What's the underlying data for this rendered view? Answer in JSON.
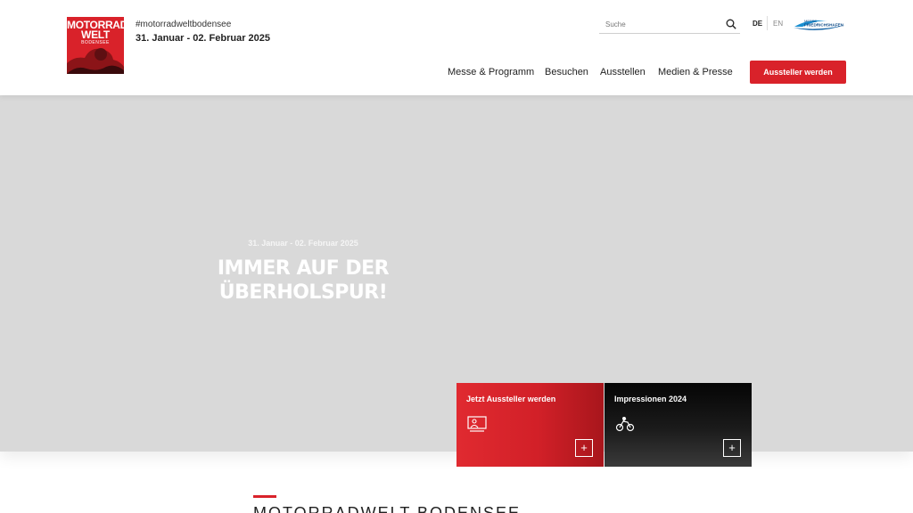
{
  "brand": {
    "logo_line1": "MOTORRAD",
    "logo_line2": "WELT",
    "logo_line3": "BODENSEE",
    "hashtag": "#motorradweltbodensee",
    "dates": "31. Januar - 02. Februar 2025",
    "color": "#d9222a"
  },
  "search": {
    "placeholder": "Suche",
    "icon": "search-icon"
  },
  "language": {
    "de": "DE",
    "en": "EN"
  },
  "partner_logo": {
    "line1": "MESSE",
    "line2": "FRIEDRICHSHAFEN"
  },
  "nav": {
    "items": [
      "Messe & Programm",
      "Besuchen",
      "Ausstellen",
      "Medien & Presse"
    ],
    "cta": "Aussteller werden"
  },
  "hero": {
    "date": "31. Januar - 02. Februar 2025",
    "title_line1": "IMMER AUF DER",
    "title_line2": "ÜBERHOLSPUR!",
    "background": "#d9d9d9"
  },
  "cards": [
    {
      "title": "Jetzt Aussteller werden",
      "icon": "exhibitor-icon",
      "action": "+"
    },
    {
      "title": "Impressionen 2024",
      "icon": "motorcycle-icon",
      "action": "+"
    }
  ],
  "section": {
    "title": "MOTORRADWELT BODENSEE"
  }
}
